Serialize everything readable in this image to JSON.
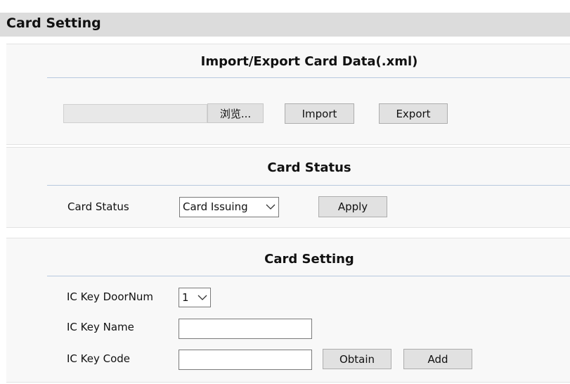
{
  "header": {
    "title": "Card Setting"
  },
  "import_export": {
    "title": "Import/Export Card Data(.xml)",
    "browse_label": "浏览...",
    "import_label": "Import",
    "export_label": "Export"
  },
  "card_status": {
    "title": "Card Status",
    "field_label": "Card Status",
    "selected_value": "Card Issuing",
    "apply_label": "Apply"
  },
  "card_setting": {
    "title": "Card Setting",
    "door_num_label": "IC Key DoorNum",
    "door_num_value": "1",
    "key_name_label": "IC Key Name",
    "key_name_value": "",
    "key_code_label": "IC Key Code",
    "key_code_value": "",
    "obtain_label": "Obtain",
    "add_label": "Add"
  }
}
